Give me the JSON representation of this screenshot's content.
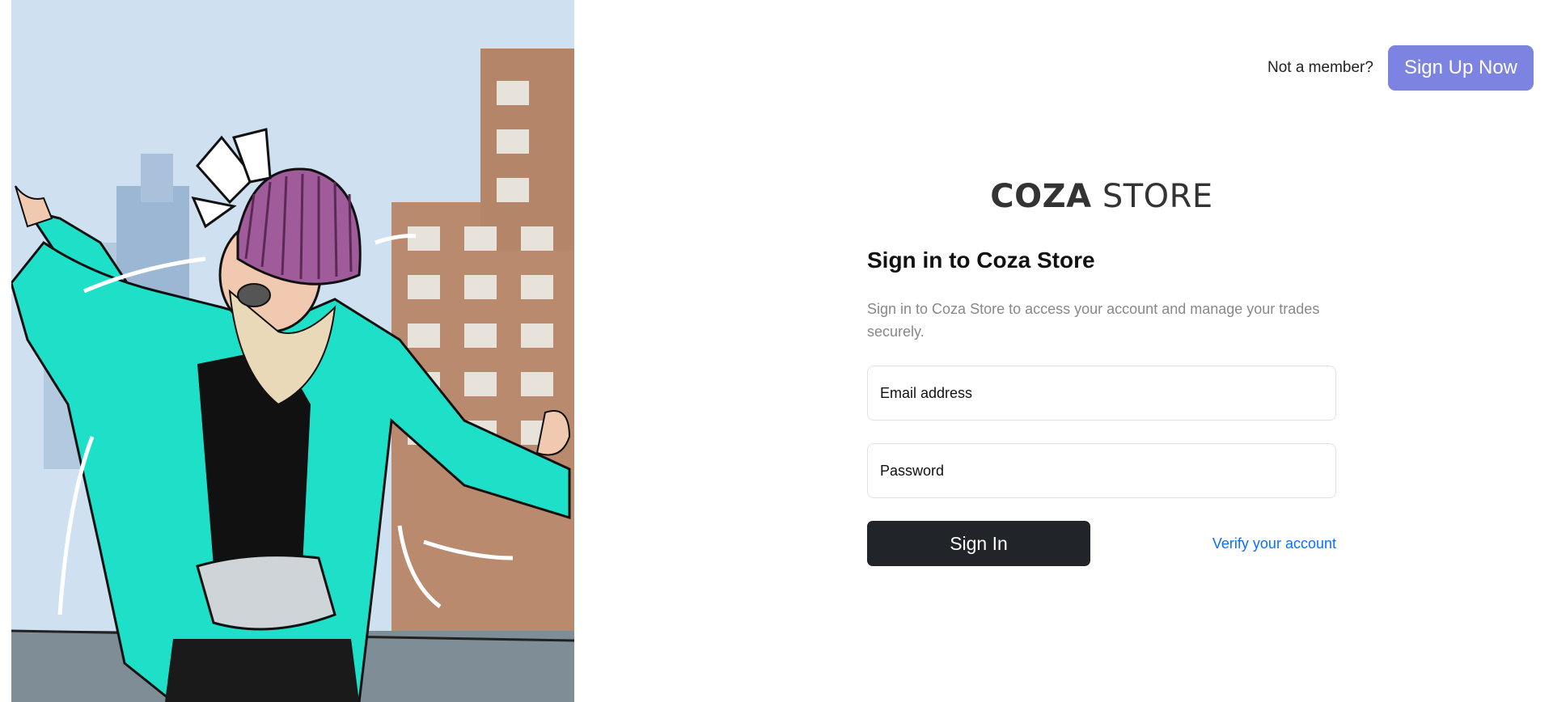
{
  "header": {
    "not_member_text": "Not a member?",
    "signup_label": "Sign Up Now"
  },
  "logo": {
    "bold_part": "COZA",
    "light_part": " STORE"
  },
  "form": {
    "title": "Sign in to Coza Store",
    "subtitle": "Sign in to Coza Store to access your account and manage your trades securely.",
    "email_placeholder": "Email address",
    "password_placeholder": "Password",
    "signin_label": "Sign In",
    "verify_label": "Verify your account"
  },
  "colors": {
    "signup_bg": "#7c83e0",
    "signin_bg": "#212529",
    "link": "#0d6efd",
    "jacket": "#1ee0c8",
    "hat": "#a05c9a"
  }
}
